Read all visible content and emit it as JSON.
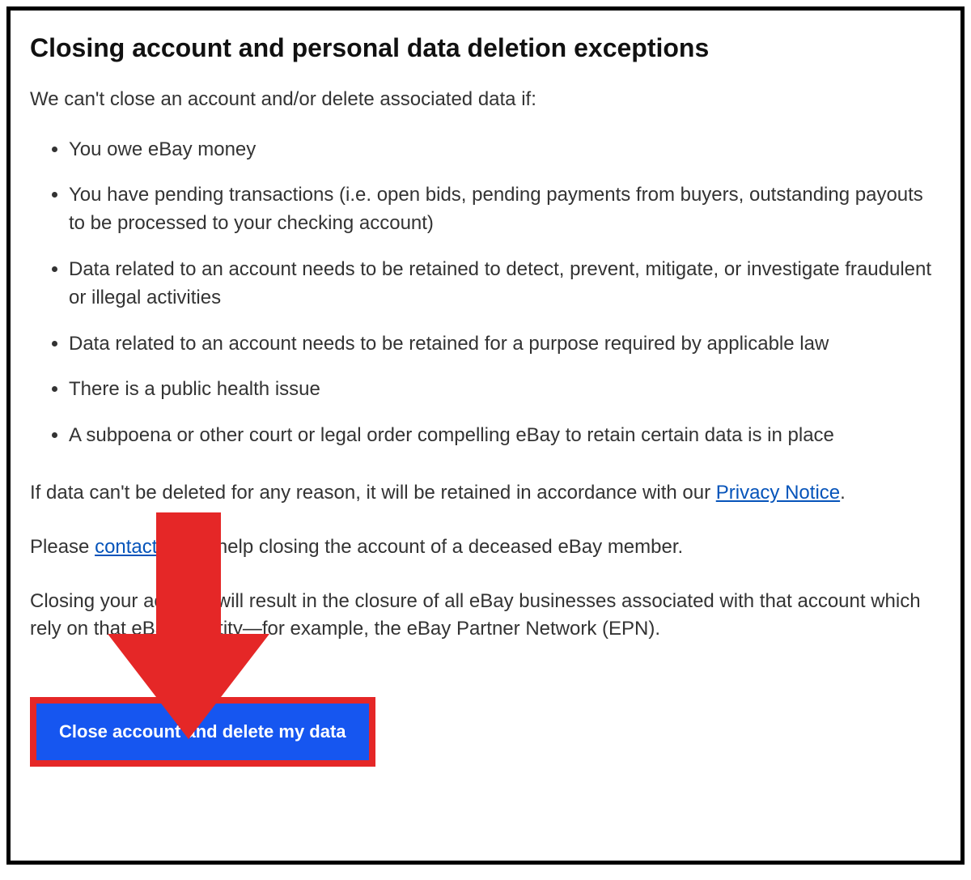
{
  "heading": "Closing account and personal data deletion exceptions",
  "intro": "We can't close an account and/or delete associated data if:",
  "exceptions": [
    "You owe eBay money",
    "You have pending transactions (i.e. open bids, pending payments from buyers, outstanding payouts to be processed to your checking account)",
    "Data related to an account needs to be retained to detect, prevent, mitigate, or investigate fraudulent or illegal activities",
    "Data related to an account needs to be retained for a purpose required by applicable law",
    "There is a public health issue",
    "A subpoena or other court or legal order compelling eBay to retain certain data is in place"
  ],
  "privacy_para_before": "If data can't be deleted for any reason, it will be retained in accordance with our ",
  "privacy_link": "Privacy Notice",
  "privacy_para_after": ".",
  "contact_para_before": "Please ",
  "contact_link": "contact us",
  "contact_para_after": " for help closing the account of a deceased eBay member.",
  "closure_para": "Closing your account will result in the closure of all eBay businesses associated with that account which rely on that eBay identity—for example, the eBay Partner Network (EPN).",
  "button_label": "Close account and delete my data",
  "arrow_color": "#e52727"
}
